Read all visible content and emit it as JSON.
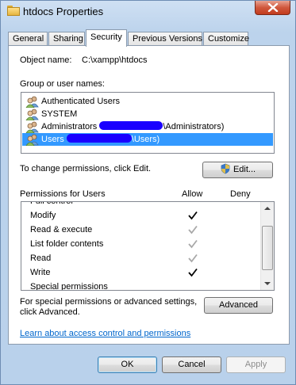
{
  "window": {
    "title": "htdocs Properties"
  },
  "tabs": [
    {
      "label": "General"
    },
    {
      "label": "Sharing"
    },
    {
      "label": "Security"
    },
    {
      "label": "Previous Versions"
    },
    {
      "label": "Customize"
    }
  ],
  "security": {
    "object_name_label": "Object name:",
    "object_name_value": "C:\\xampp\\htdocs",
    "group_label": "Group or user names:",
    "users": [
      {
        "prefix": "Authenticated Users",
        "suffix": ""
      },
      {
        "prefix": "SYSTEM",
        "suffix": ""
      },
      {
        "prefix": "Administrators ",
        "suffix": "\\Administrators)"
      },
      {
        "prefix": "Users ",
        "suffix": "\\Users)"
      }
    ],
    "change_text": "To change permissions, click Edit.",
    "edit_button": "Edit...",
    "permissions_for": "Permissions for Users",
    "allow_header": "Allow",
    "deny_header": "Deny",
    "permissions": [
      {
        "name": "Full control",
        "allow": "none"
      },
      {
        "name": "Modify",
        "allow": "explicit"
      },
      {
        "name": "Read & execute",
        "allow": "inherited"
      },
      {
        "name": "List folder contents",
        "allow": "inherited"
      },
      {
        "name": "Read",
        "allow": "inherited"
      },
      {
        "name": "Write",
        "allow": "explicit"
      },
      {
        "name": "Special permissions",
        "allow": "none"
      }
    ],
    "advanced_text_line1": "For special permissions or advanced settings,",
    "advanced_text_line2": "click Advanced.",
    "advanced_button": "Advanced",
    "learn_link": "Learn about access control and permissions"
  },
  "footer": {
    "ok": "OK",
    "cancel": "Cancel",
    "apply": "Apply"
  },
  "colors": {
    "selection": "#3399ff",
    "redaction": "#1a00ff",
    "link": "#0066cc"
  }
}
